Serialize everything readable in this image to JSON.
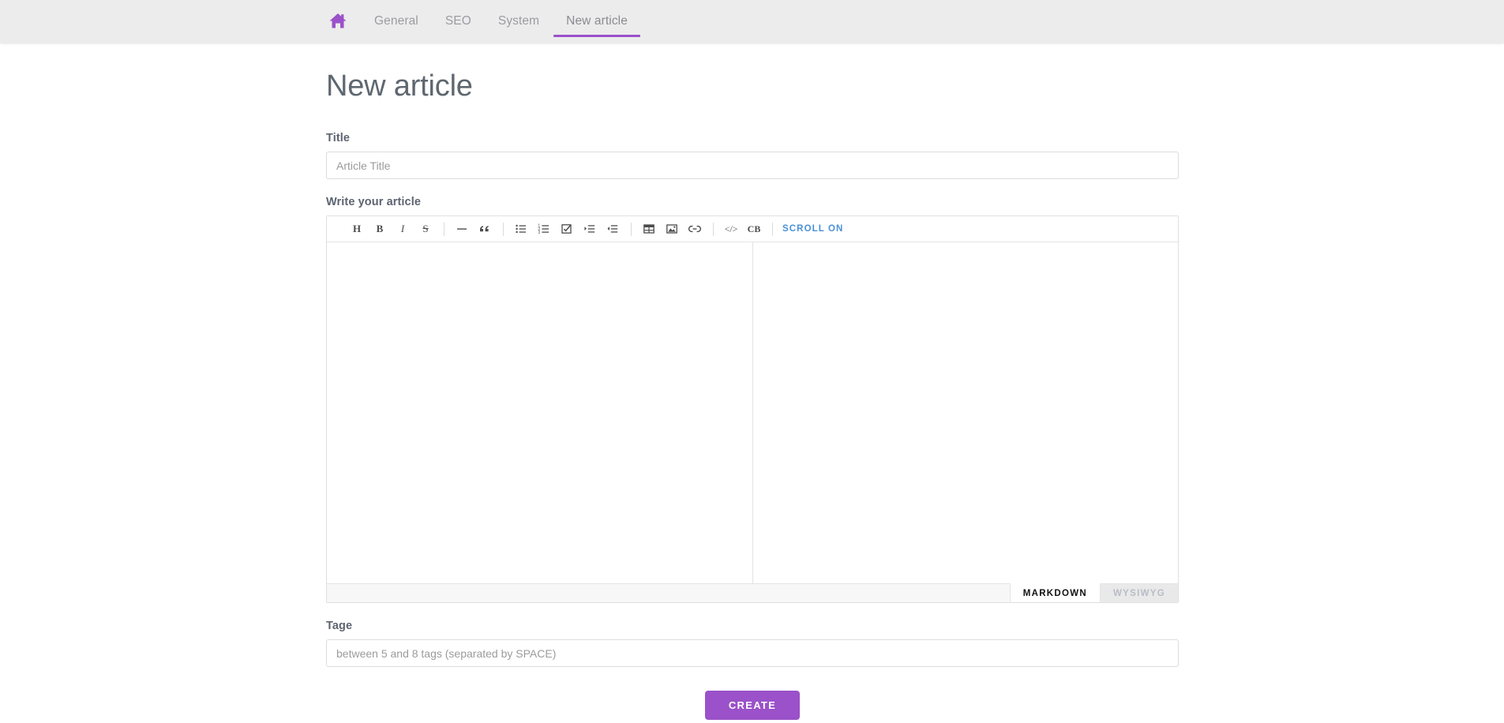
{
  "nav": {
    "home_icon": "home-icon",
    "items": [
      {
        "label": "General",
        "active": false
      },
      {
        "label": "SEO",
        "active": false
      },
      {
        "label": "System",
        "active": false
      },
      {
        "label": "New article",
        "active": true
      }
    ],
    "accent_color": "#9b51c9",
    "background_color": "#ececec"
  },
  "page": {
    "title": "New article"
  },
  "form": {
    "title_field": {
      "label": "Title",
      "placeholder": "Article Title",
      "value": ""
    },
    "article_field": {
      "label": "Write your article",
      "value": ""
    },
    "tags_field": {
      "label": "Tage",
      "placeholder": "between 5 and 8 tags (separated by SPACE)",
      "value": ""
    },
    "submit_label": "CREATE",
    "submit_color": "#9b51c9"
  },
  "editor": {
    "toolbar": [
      {
        "name": "heading-icon",
        "glyph": "H",
        "type": "text"
      },
      {
        "name": "bold-icon",
        "glyph": "B",
        "type": "text"
      },
      {
        "name": "italic-icon",
        "glyph": "I",
        "type": "text"
      },
      {
        "name": "strikethrough-icon",
        "glyph": "S",
        "type": "text"
      },
      {
        "name": "separator",
        "type": "sep"
      },
      {
        "name": "horizontal-rule-icon",
        "type": "svg"
      },
      {
        "name": "blockquote-icon",
        "type": "svg"
      },
      {
        "name": "separator",
        "type": "sep"
      },
      {
        "name": "bullet-list-icon",
        "type": "svg"
      },
      {
        "name": "numbered-list-icon",
        "type": "svg"
      },
      {
        "name": "task-list-icon",
        "type": "svg"
      },
      {
        "name": "indent-icon",
        "type": "svg"
      },
      {
        "name": "outdent-icon",
        "type": "svg"
      },
      {
        "name": "separator",
        "type": "sep"
      },
      {
        "name": "table-icon",
        "type": "svg"
      },
      {
        "name": "image-icon",
        "type": "svg"
      },
      {
        "name": "link-icon",
        "type": "svg"
      },
      {
        "name": "separator",
        "type": "sep"
      },
      {
        "name": "inline-code-icon",
        "glyph": "</>",
        "type": "text"
      },
      {
        "name": "code-block-icon",
        "glyph": "CB",
        "type": "text"
      },
      {
        "name": "separator",
        "type": "sep"
      }
    ],
    "scroll_sync_label": "SCROLL ON",
    "scroll_sync_color": "#4a90d9",
    "mode_tabs": [
      {
        "label": "MARKDOWN",
        "active": true
      },
      {
        "label": "WYSIWYG",
        "active": false
      }
    ],
    "panes": {
      "markdown_source": "",
      "preview": ""
    }
  }
}
